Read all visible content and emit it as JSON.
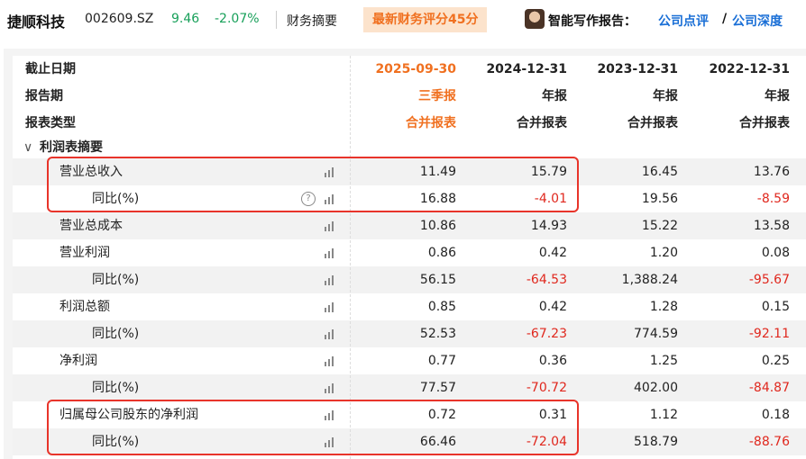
{
  "header": {
    "company": "捷顺科技",
    "code": "002609.SZ",
    "price": "9.46",
    "change": "-2.07%",
    "tab": "财务摘要",
    "score": "最新财务评分45分",
    "report_label": "智能写作报告：",
    "link1": "公司点评",
    "slash": "/",
    "link2": "公司深度"
  },
  "table": {
    "head_rows": [
      {
        "label": "截止日期",
        "values": [
          "2025-09-30",
          "2024-12-31",
          "2023-12-31",
          "2022-12-31"
        ]
      },
      {
        "label": "报告期",
        "values": [
          "三季报",
          "年报",
          "年报",
          "年报"
        ]
      },
      {
        "label": "报表类型",
        "values": [
          "合并报表",
          "合并报表",
          "合并报表",
          "合并报表"
        ]
      }
    ],
    "section": "利润表摘要",
    "rows": [
      {
        "label": "营业总收入",
        "values": [
          "11.49",
          "15.79",
          "16.45",
          "13.76"
        ]
      },
      {
        "label": "同比(%)",
        "values": [
          "16.88",
          "-4.01",
          "19.56",
          "-8.59"
        ]
      },
      {
        "label": "营业总成本",
        "values": [
          "10.86",
          "14.93",
          "15.22",
          "13.58"
        ]
      },
      {
        "label": "营业利润",
        "values": [
          "0.86",
          "0.42",
          "1.20",
          "0.08"
        ]
      },
      {
        "label": "同比(%)",
        "values": [
          "56.15",
          "-64.53",
          "1,388.24",
          "-95.67"
        ]
      },
      {
        "label": "利润总额",
        "values": [
          "0.85",
          "0.42",
          "1.28",
          "0.15"
        ]
      },
      {
        "label": "同比(%)",
        "values": [
          "52.53",
          "-67.23",
          "774.59",
          "-92.11"
        ]
      },
      {
        "label": "净利润",
        "values": [
          "0.77",
          "0.36",
          "1.25",
          "0.25"
        ]
      },
      {
        "label": "同比(%)",
        "values": [
          "77.57",
          "-70.72",
          "402.00",
          "-84.87"
        ]
      },
      {
        "label": "归属母公司股东的净利润",
        "values": [
          "0.72",
          "0.31",
          "1.12",
          "0.18"
        ]
      },
      {
        "label": "同比(%)",
        "values": [
          "66.46",
          "-72.04",
          "518.79",
          "-88.76"
        ]
      }
    ]
  },
  "colors": {
    "accent_orange": "#f07020",
    "negative_red": "#e0281e",
    "positive_green": "#18a05a",
    "link_blue": "#1a6fd6",
    "highlight_box": "#e8342a"
  },
  "icons": {
    "chart": "bar-chart-icon",
    "help": "question-circle-icon",
    "collapse": "chevron-down-icon"
  }
}
